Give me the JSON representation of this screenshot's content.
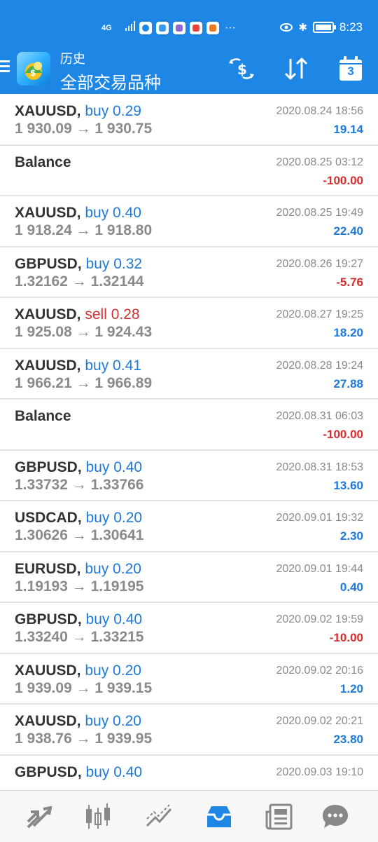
{
  "status": {
    "signal": "4G",
    "time": "8:23"
  },
  "header": {
    "subtitle": "历史",
    "title": "全部交易品种",
    "calendar_day": "3"
  },
  "trades": [
    {
      "symbol": "XAUUSD,",
      "dir": "buy",
      "lots": "buy 0.29",
      "prices": "1 930.09 → 1 930.75",
      "time": "2020.08.24 18:56",
      "profit": "19.14",
      "sign": "pos"
    },
    {
      "symbol": "Balance",
      "dir": "",
      "lots": "",
      "prices": "",
      "time": "2020.08.25 03:12",
      "profit": "-100.00",
      "sign": "neg"
    },
    {
      "symbol": "XAUUSD,",
      "dir": "buy",
      "lots": "buy 0.40",
      "prices": "1 918.24 → 1 918.80",
      "time": "2020.08.25 19:49",
      "profit": "22.40",
      "sign": "pos"
    },
    {
      "symbol": "GBPUSD,",
      "dir": "buy",
      "lots": "buy 0.32",
      "prices": "1.32162 → 1.32144",
      "time": "2020.08.26 19:27",
      "profit": "-5.76",
      "sign": "neg"
    },
    {
      "symbol": "XAUUSD,",
      "dir": "sell",
      "lots": "sell 0.28",
      "prices": "1 925.08 → 1 924.43",
      "time": "2020.08.27 19:25",
      "profit": "18.20",
      "sign": "pos"
    },
    {
      "symbol": "XAUUSD,",
      "dir": "buy",
      "lots": "buy 0.41",
      "prices": "1 966.21 → 1 966.89",
      "time": "2020.08.28 19:24",
      "profit": "27.88",
      "sign": "pos"
    },
    {
      "symbol": "Balance",
      "dir": "",
      "lots": "",
      "prices": "",
      "time": "2020.08.31 06:03",
      "profit": "-100.00",
      "sign": "neg"
    },
    {
      "symbol": "GBPUSD,",
      "dir": "buy",
      "lots": "buy 0.40",
      "prices": "1.33732 → 1.33766",
      "time": "2020.08.31 18:53",
      "profit": "13.60",
      "sign": "pos"
    },
    {
      "symbol": "USDCAD,",
      "dir": "buy",
      "lots": "buy 0.20",
      "prices": "1.30626 → 1.30641",
      "time": "2020.09.01 19:32",
      "profit": "2.30",
      "sign": "pos"
    },
    {
      "symbol": "EURUSD,",
      "dir": "buy",
      "lots": "buy 0.20",
      "prices": "1.19193 → 1.19195",
      "time": "2020.09.01 19:44",
      "profit": "0.40",
      "sign": "pos"
    },
    {
      "symbol": "GBPUSD,",
      "dir": "buy",
      "lots": "buy 0.40",
      "prices": "1.33240 → 1.33215",
      "time": "2020.09.02 19:59",
      "profit": "-10.00",
      "sign": "neg"
    },
    {
      "symbol": "XAUUSD,",
      "dir": "buy",
      "lots": "buy 0.20",
      "prices": "1 939.09 → 1 939.15",
      "time": "2020.09.02 20:16",
      "profit": "1.20",
      "sign": "pos"
    },
    {
      "symbol": "XAUUSD,",
      "dir": "buy",
      "lots": "buy 0.20",
      "prices": "1 938.76 → 1 939.95",
      "time": "2020.09.02 20:21",
      "profit": "23.80",
      "sign": "pos"
    },
    {
      "symbol": "GBPUSD,",
      "dir": "buy",
      "lots": "buy 0.40",
      "prices": "",
      "time": "2020.09.03 19:10",
      "profit": "",
      "sign": "pos"
    }
  ],
  "bottom_nav": [
    "trade-icon",
    "quotes-icon",
    "chart-icon",
    "history-icon",
    "news-icon",
    "chat-icon"
  ],
  "colors": {
    "header_bg": "#1e87e6",
    "buy": "#1e7ad6",
    "sell": "#d32f2f",
    "active_tab": "#1e87e6"
  }
}
